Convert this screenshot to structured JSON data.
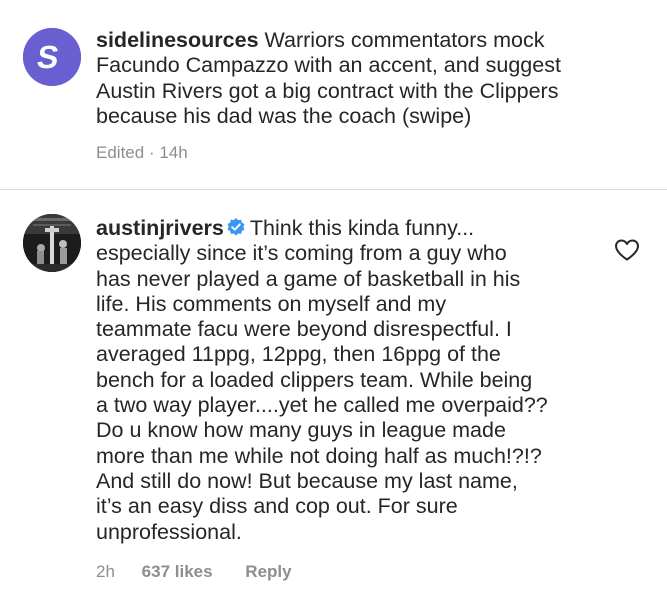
{
  "caption": {
    "username": "sidelinesources",
    "avatar_letter": "S",
    "avatar_color": "#6a5fd0",
    "text_lines": [
      "Warriors commentators mock",
      "Facundo Campazzo with an accent, and suggest",
      "Austin Rivers got a big contract with the Clippers",
      "because his dad was the coach (swipe)"
    ],
    "edited_label": "Edited",
    "separator": "·",
    "time": "14h"
  },
  "comment": {
    "username": "austinjrivers",
    "verified_icon": "verified-badge-icon",
    "verified_color": "#3897f0",
    "text_lines": [
      "Think this kinda funny...",
      "especially since it’s coming from a guy who",
      "has never played a game of basketball in his",
      "life. His comments on myself and my",
      "teammate facu were beyond disrespectful. I",
      "averaged 11ppg, 12ppg, then 16ppg of the",
      "bench for a loaded clippers team. While being",
      "a two way player....yet he called me overpaid??",
      "Do u know how many guys in league  made",
      "more than me while not doing half as much!?!?",
      "And still do now! But because my last name,",
      "it’s an easy diss and cop out. For sure",
      "unprofessional."
    ],
    "time": "2h",
    "likes": "637 likes",
    "reply_label": "Reply",
    "like_icon": "heart-outline-icon"
  }
}
